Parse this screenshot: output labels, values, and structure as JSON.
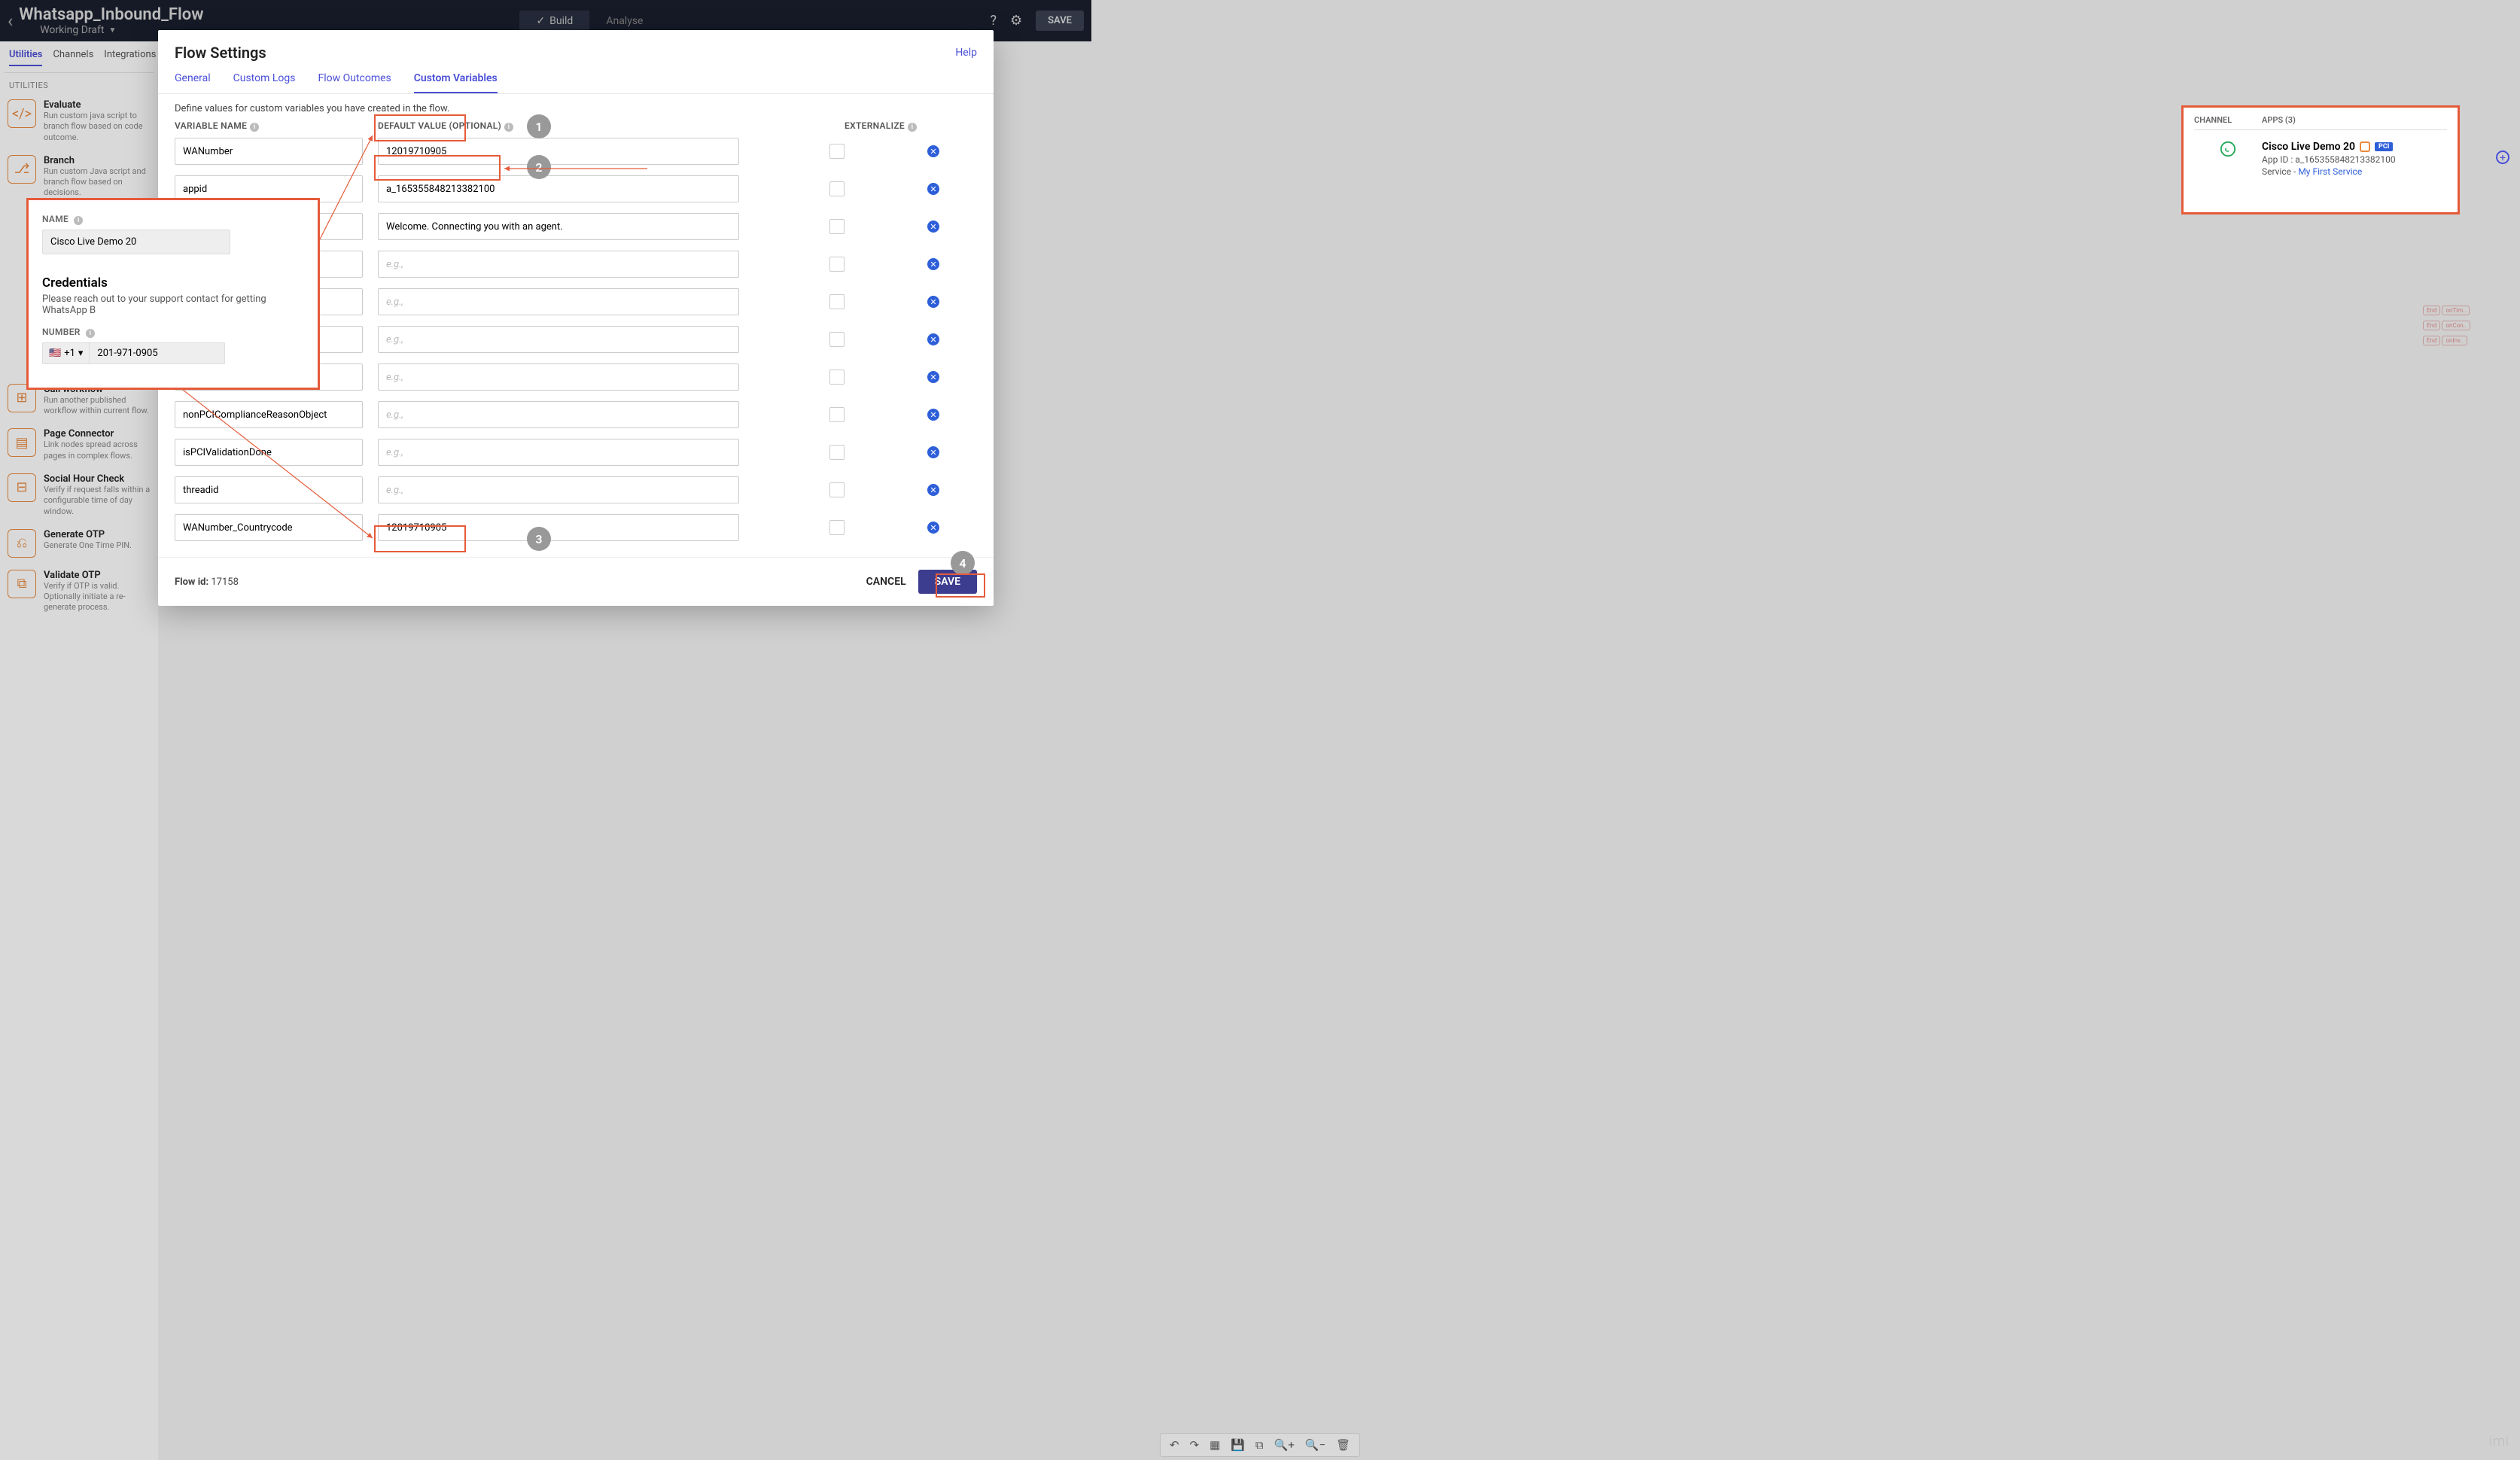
{
  "header": {
    "title": "Whatsapp_Inbound_Flow",
    "subtitle": "Working Draft",
    "build": "Build",
    "analyse": "Analyse",
    "save": "SAVE"
  },
  "sidebar": {
    "tabs": [
      "Utilities",
      "Channels",
      "Integrations"
    ],
    "section": "UTILITIES",
    "items": [
      {
        "t": "Evaluate",
        "d": "Run custom java script to branch flow based on code outcome."
      },
      {
        "t": "Branch",
        "d": "Run custom Java script and branch flow based on decisions."
      },
      {
        "t": "Call workflow",
        "d": "Run another published workflow within current flow."
      },
      {
        "t": "Page Connector",
        "d": "Link nodes spread across pages in complex flows."
      },
      {
        "t": "Social Hour Check",
        "d": "Verify if request falls within a configurable time of day window."
      },
      {
        "t": "Generate OTP",
        "d": "Generate One Time PIN."
      },
      {
        "t": "Validate OTP",
        "d": "Verify if OTP is valid. Optionally initiate a re-generate process."
      }
    ]
  },
  "modal": {
    "title": "Flow Settings",
    "help": "Help",
    "tabs": [
      "General",
      "Custom Logs",
      "Flow Outcomes",
      "Custom Variables"
    ],
    "active_tab": "Custom Variables",
    "desc": "Define values for custom variables you have created in the flow.",
    "col_name": "VARIABLE NAME",
    "col_value": "DEFAULT VALUE (OPTIONAL)",
    "col_ext": "EXTERNALIZE",
    "placeholder": "e.g.,",
    "rows": [
      {
        "name": "WANumber",
        "value": "12019710905"
      },
      {
        "name": "appid",
        "value": "a_165355848213382100"
      },
      {
        "name": "",
        "value": "Welcome. Connecting you with an agent."
      },
      {
        "name": "",
        "value": ""
      },
      {
        "name": "",
        "value": ""
      },
      {
        "name": "",
        "value": ""
      },
      {
        "name": "",
        "value": ""
      },
      {
        "name": "nonPCIComplianceReasonObject",
        "value": ""
      },
      {
        "name": "isPCIValidationDone",
        "value": ""
      },
      {
        "name": "threadid",
        "value": ""
      },
      {
        "name": "WANumber_Countrycode",
        "value": "12019710905"
      }
    ],
    "flow_id_label": "Flow id:",
    "flow_id": "17158",
    "cancel": "CANCEL",
    "save": "SAVE"
  },
  "cred_popup": {
    "name_label": "NAME",
    "name_value": "Cisco Live Demo 20",
    "cred_title": "Credentials",
    "cred_sub": "Please reach out to your support contact for getting WhatsApp B",
    "number_label": "NUMBER",
    "cc": "+1",
    "number": "201-971-0905"
  },
  "apps_popup": {
    "col_channel": "CHANNEL",
    "col_apps": "APPS (3)",
    "app_name": "Cisco Live Demo 20",
    "pci": "PCI",
    "app_id_label": "App ID :",
    "app_id": "a_165355848213382100",
    "service_label": "Service -",
    "service_link": "My First Service"
  },
  "circles": {
    "c1": "1",
    "c2": "2",
    "c3": "3",
    "c4": "4"
  },
  "brand": "imi"
}
